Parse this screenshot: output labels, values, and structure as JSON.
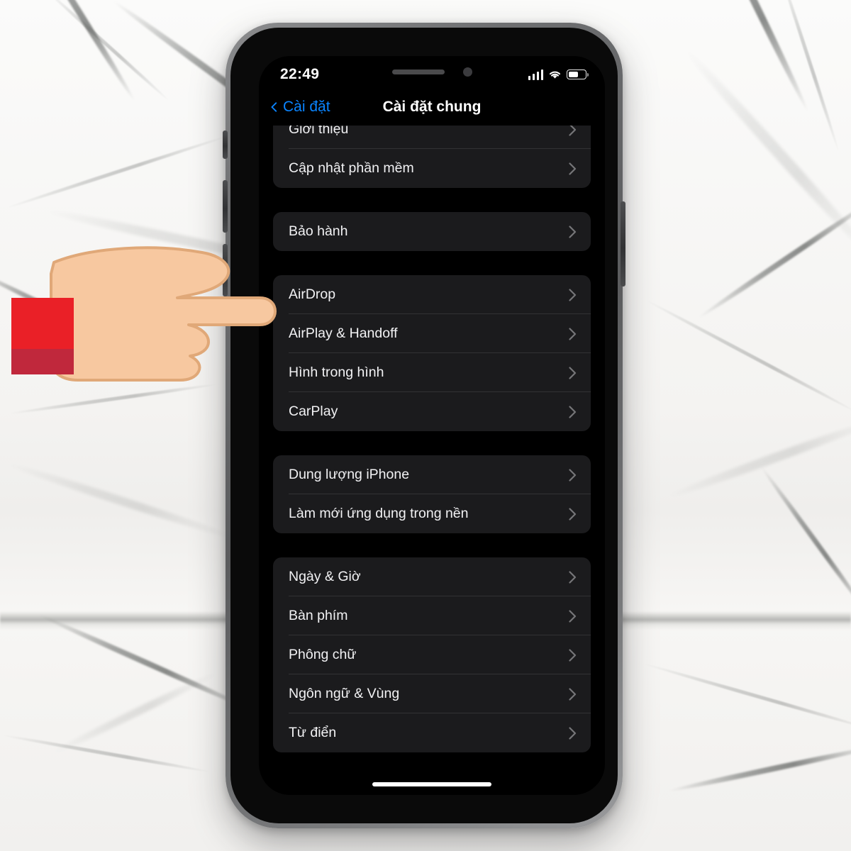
{
  "status_bar": {
    "time": "22:49",
    "signal_icon": "cellular-signal-icon",
    "signal_bars": 4,
    "wifi_icon": "wifi-icon",
    "battery_icon": "battery-icon",
    "battery_percent": 58
  },
  "nav": {
    "back_icon": "chevron-left-icon",
    "back_label": "Cài đặt",
    "title": "Cài đặt chung"
  },
  "colors": {
    "accent_blue": "#0a84ff",
    "card_bg": "#1b1b1d",
    "screen_bg": "#000000",
    "separator": "#323234",
    "label": "#f2f2f4",
    "sleeve_red": "#ea2027",
    "sleeve_cuff_red": "#c0283c",
    "skin": "#f7c8a0"
  },
  "groups": [
    {
      "name": "about-group",
      "rows": [
        {
          "label": "Giới thiệu",
          "chevron": "chevron-right-icon"
        },
        {
          "label": "Cập nhật phần mềm",
          "chevron": "chevron-right-icon"
        }
      ]
    },
    {
      "name": "warranty-group",
      "rows": [
        {
          "label": "Bảo hành",
          "chevron": "chevron-right-icon"
        }
      ]
    },
    {
      "name": "connectivity-group",
      "rows": [
        {
          "label": "AirDrop",
          "chevron": "chevron-right-icon"
        },
        {
          "label": "AirPlay & Handoff",
          "chevron": "chevron-right-icon"
        },
        {
          "label": "Hình trong hình",
          "chevron": "chevron-right-icon"
        },
        {
          "label": "CarPlay",
          "chevron": "chevron-right-icon"
        }
      ]
    },
    {
      "name": "storage-group",
      "rows": [
        {
          "label": "Dung lượng iPhone",
          "chevron": "chevron-right-icon"
        },
        {
          "label": "Làm mới ứng dụng trong nền",
          "chevron": "chevron-right-icon"
        }
      ]
    },
    {
      "name": "localization-group",
      "rows": [
        {
          "label": "Ngày & Giờ",
          "chevron": "chevron-right-icon"
        },
        {
          "label": "Bàn phím",
          "chevron": "chevron-right-icon"
        },
        {
          "label": "Phông chữ",
          "chevron": "chevron-right-icon"
        },
        {
          "label": "Ngôn ngữ & Vùng",
          "chevron": "chevron-right-icon"
        },
        {
          "label": "Từ điển",
          "chevron": "chevron-right-icon"
        }
      ]
    }
  ],
  "annotation": {
    "pointer_icon": "pointing-hand-icon",
    "points_at": "AirDrop"
  },
  "device": {
    "side_buttons": [
      "mute-switch",
      "volume-up-button",
      "volume-down-button",
      "power-button"
    ],
    "notch_items": [
      "speaker-grille",
      "front-camera"
    ],
    "home_indicator": "home-indicator"
  }
}
